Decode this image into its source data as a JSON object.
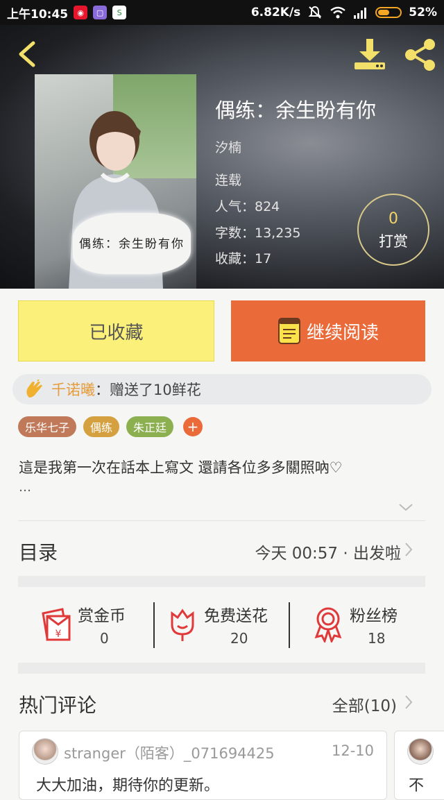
{
  "status_bar": {
    "time": "上午10:45",
    "speed": "6.82K/s",
    "battery_percent": "52%",
    "battery_level": 0.52
  },
  "colors": {
    "accent_orange": "#ea6a3a",
    "fav_yellow": "#fbf07a",
    "tag_brown": "#c07a5a",
    "tag_gold": "#d4a040",
    "tag_green": "#8caf50",
    "gift_name": "#e69b3a"
  },
  "book": {
    "title": "偶练：余生盼有你",
    "author": "汐楠",
    "status": "连载",
    "popularity": "人气：824",
    "word_count": "字数：13,235",
    "favorites": "收藏：17",
    "cover_text": "偶练：余生盼有你",
    "reward_count": "0",
    "reward_label": "打赏"
  },
  "actions": {
    "favorited_label": "已收藏",
    "continue_label": "继续阅读"
  },
  "gift": {
    "user": "千诺曦",
    "text": "：赠送了10鲜花"
  },
  "tags": [
    {
      "label": "乐华七子",
      "color": "#c07a5a"
    },
    {
      "label": "偶练",
      "color": "#d4a040"
    },
    {
      "label": "朱正廷",
      "color": "#8caf50"
    }
  ],
  "tag_add": "+",
  "description": "這是我第一次在話本上寫文 還請各位多多關照吶♡",
  "description_ellipsis": "…",
  "toc": {
    "label": "目录",
    "latest": "今天 00:57 · 出发啦"
  },
  "stats": [
    {
      "label": "赏金币",
      "value": "0",
      "icon": "red-packet-icon"
    },
    {
      "label": "免费送花",
      "value": "20",
      "icon": "flower-icon"
    },
    {
      "label": "粉丝榜",
      "value": "18",
      "icon": "medal-icon"
    }
  ],
  "comments_section": {
    "label": "热门评论",
    "all": "全部(10)"
  },
  "comments": [
    {
      "user": "stranger（陌客）_071694425",
      "date": "12-10",
      "body": "大大加油，期待你的更新。"
    },
    {
      "user": "",
      "date": "",
      "body": "不"
    }
  ]
}
